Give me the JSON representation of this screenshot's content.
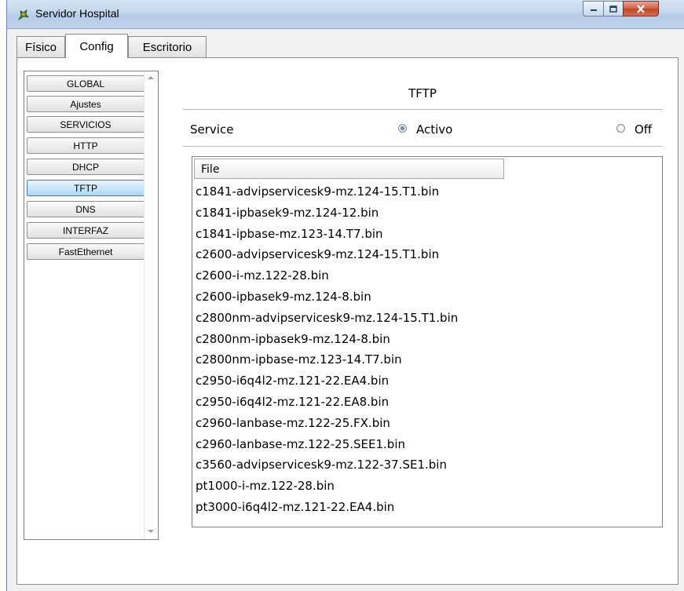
{
  "window": {
    "title": "Servidor Hospital",
    "icon": "cisco-server-icon",
    "controls": [
      "minimize-icon",
      "maximize-icon",
      "close-icon"
    ]
  },
  "tabs": [
    {
      "label": "Físico",
      "active": false
    },
    {
      "label": "Config",
      "active": true
    },
    {
      "label": "Escritorio",
      "active": false
    }
  ],
  "sidebar": {
    "items": [
      {
        "label": "GLOBAL",
        "selected": false
      },
      {
        "label": "Ajustes",
        "selected": false
      },
      {
        "label": "SERVICIOS",
        "selected": false
      },
      {
        "label": "HTTP",
        "selected": false
      },
      {
        "label": "DHCP",
        "selected": false
      },
      {
        "label": "TFTP",
        "selected": true
      },
      {
        "label": "DNS",
        "selected": false
      },
      {
        "label": "INTERFAZ",
        "selected": false
      },
      {
        "label": "FastEthernet",
        "selected": false
      }
    ]
  },
  "panel": {
    "title": "TFTP",
    "service_label": "Service",
    "on_label": "Activo",
    "off_label": "Off",
    "selected": "Activo"
  },
  "files": {
    "header": "File",
    "rows": [
      "c1841-advipservicesk9-mz.124-15.T1.bin",
      "c1841-ipbasek9-mz.124-12.bin",
      "c1841-ipbase-mz.123-14.T7.bin",
      "c2600-advipservicesk9-mz.124-15.T1.bin",
      "c2600-i-mz.122-28.bin",
      "c2600-ipbasek9-mz.124-8.bin",
      "c2800nm-advipservicesk9-mz.124-15.T1.bin",
      "c2800nm-ipbasek9-mz.124-8.bin",
      "c2800nm-ipbase-mz.123-14.T7.bin",
      "c2950-i6q4l2-mz.121-22.EA4.bin",
      "c2950-i6q4l2-mz.121-22.EA8.bin",
      "c2960-lanbase-mz.122-25.FX.bin",
      "c2960-lanbase-mz.122-25.SEE1.bin",
      "c3560-advipservicesk9-mz.122-37.SE1.bin",
      "pt1000-i-mz.122-28.bin",
      "pt3000-i6q4l2-mz.121-22.EA4.bin"
    ]
  }
}
